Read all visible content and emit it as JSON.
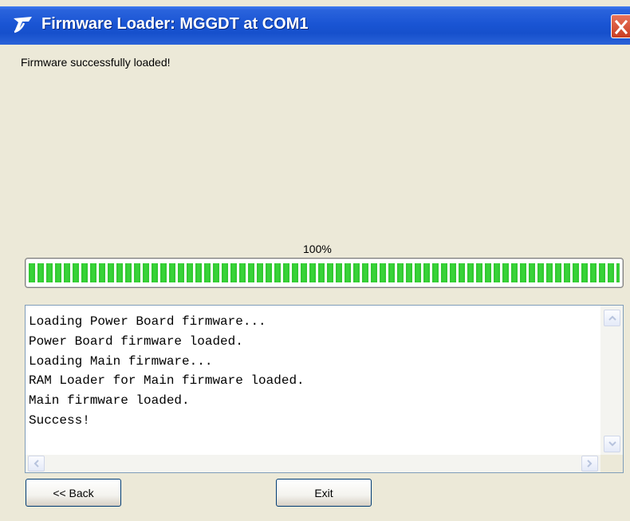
{
  "window": {
    "title": "Firmware Loader:  MGGDT at COM1",
    "app_icon": "app-logo-icon",
    "close_icon": "close-icon",
    "title_bar_color": "#1650cc",
    "close_color": "#c93e22"
  },
  "status": {
    "message": "Firmware successfully loaded!"
  },
  "progress": {
    "label": "100%",
    "value": 1.0,
    "fill_color": "#2fc52f"
  },
  "log": {
    "lines": [
      "Loading Power Board firmware...",
      "Power Board firmware loaded.",
      "Loading Main firmware...",
      "RAM Loader for Main firmware loaded.",
      "Main firmware loaded.",
      "Success!"
    ]
  },
  "buttons": {
    "back_label": "<< Back",
    "exit_label": "Exit"
  }
}
